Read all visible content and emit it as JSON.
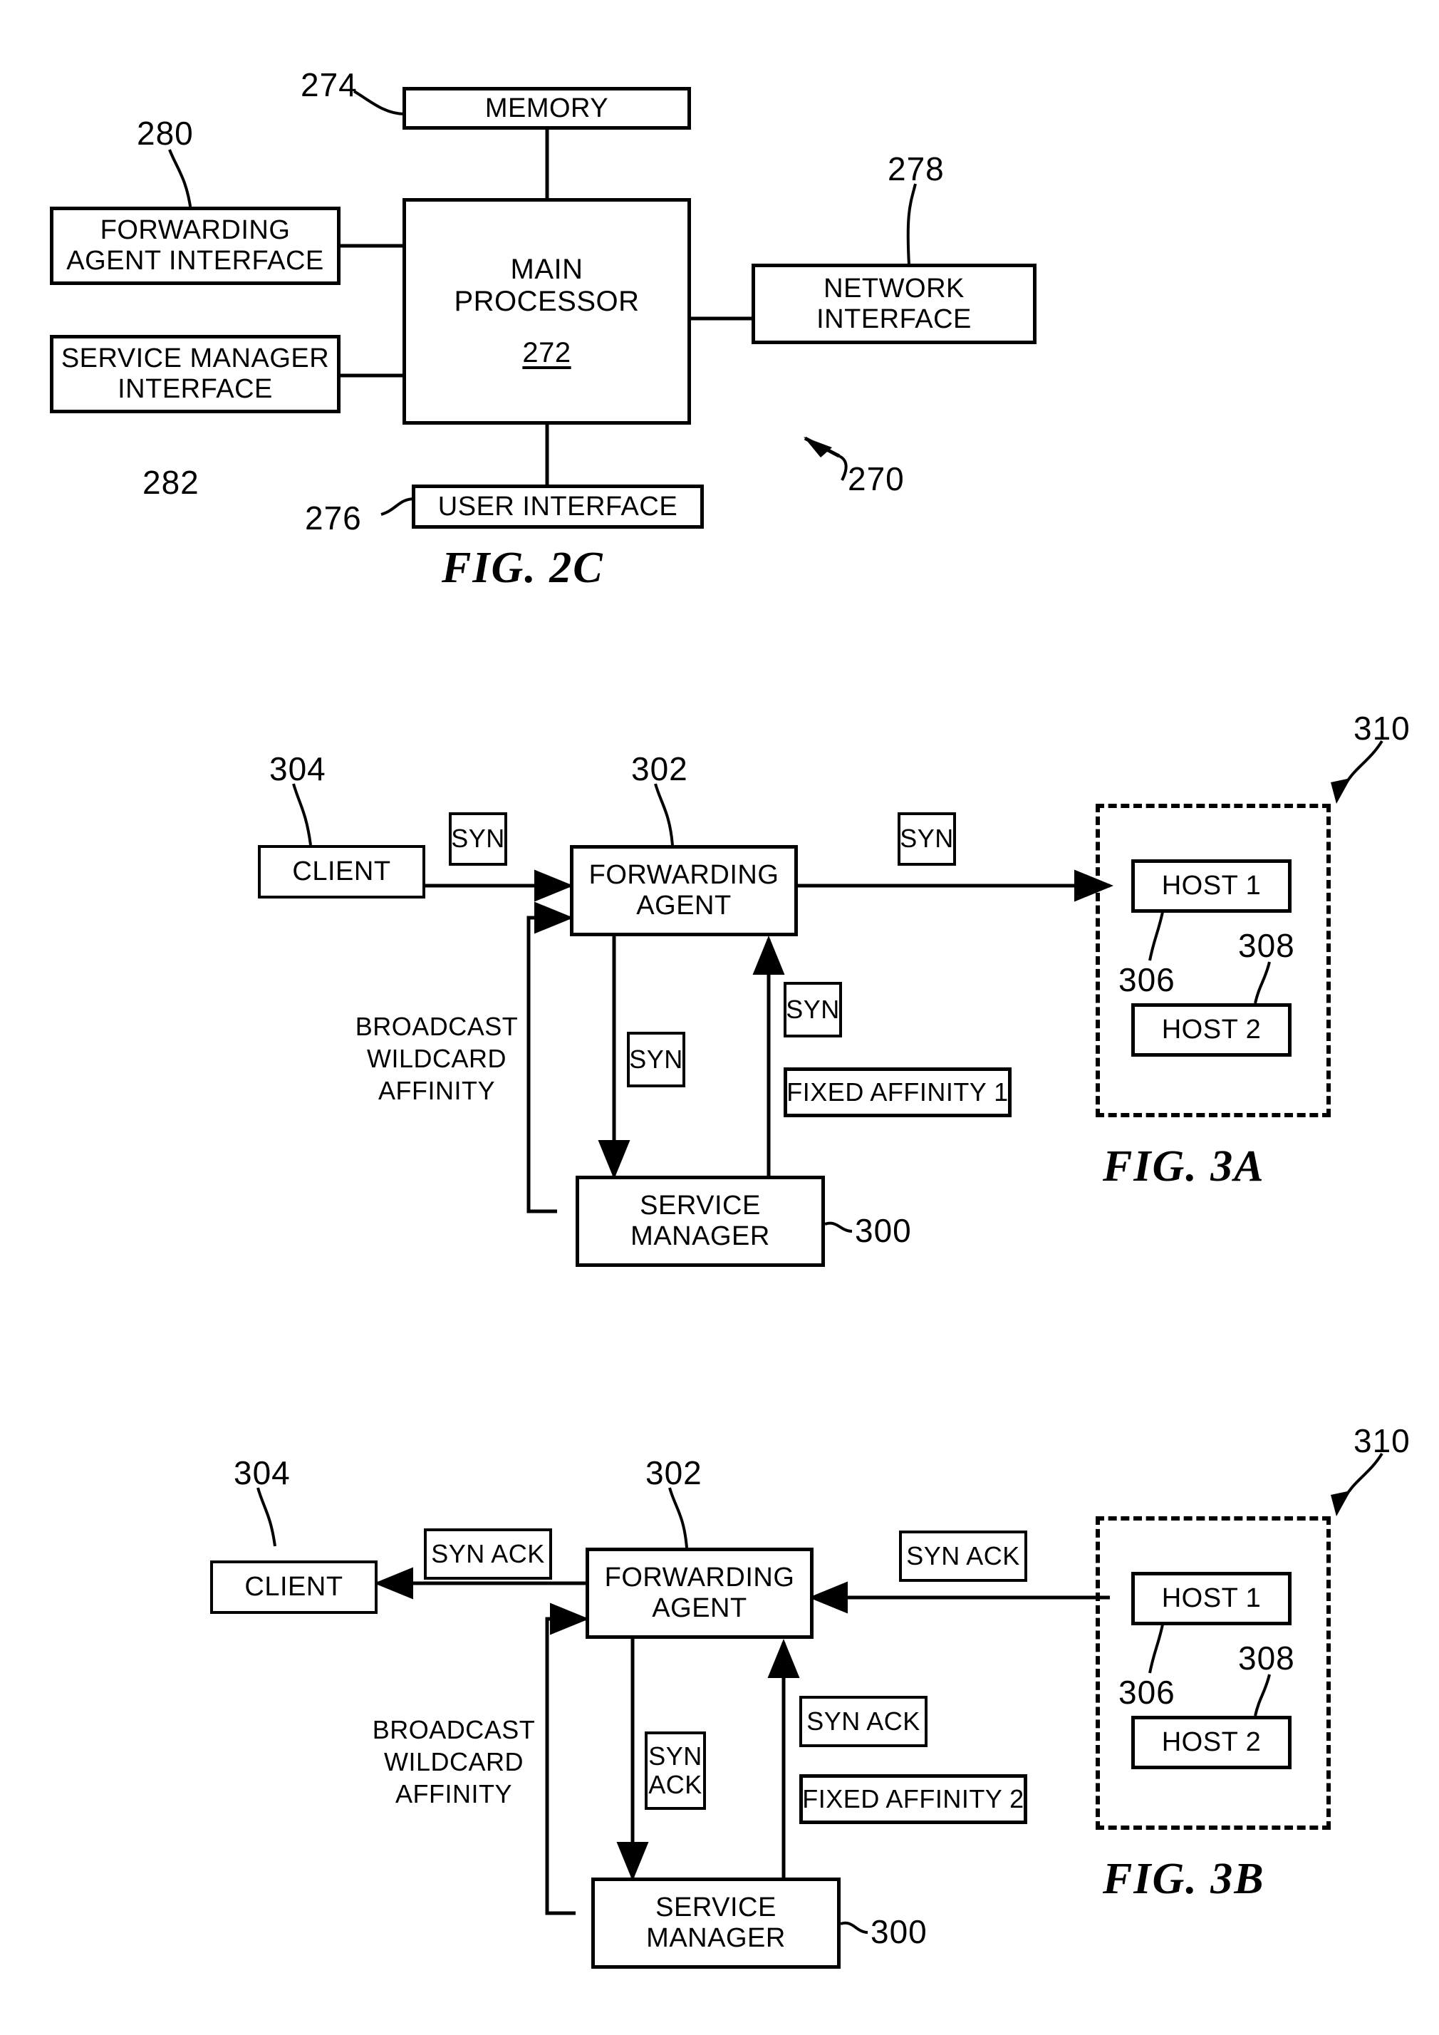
{
  "document": {
    "type": "patent-drawing-sheet",
    "figures": [
      "FIG. 2C",
      "FIG. 3A",
      "FIG. 3B"
    ]
  },
  "fig2c": {
    "caption": "FIG. 2C",
    "boxes": {
      "memory": "MEMORY",
      "forwarding_agent_interface_line1": "FORWARDING",
      "forwarding_agent_interface_line2": "AGENT INTERFACE",
      "service_manager_interface_line1": "SERVICE MANAGER",
      "service_manager_interface_line2": "INTERFACE",
      "main_processor_line1": "MAIN",
      "main_processor_line2": "PROCESSOR",
      "main_processor_ref": "272",
      "network_interface_line1": "NETWORK",
      "network_interface_line2": "INTERFACE",
      "user_interface": "USER INTERFACE"
    },
    "refs": {
      "memory": "274",
      "forwarding_agent_interface": "280",
      "service_manager_interface": "282",
      "network_interface": "278",
      "user_interface": "276",
      "system": "270"
    }
  },
  "fig3a": {
    "caption": "FIG. 3A",
    "boxes": {
      "client": "CLIENT",
      "forwarding_agent_line1": "FORWARDING",
      "forwarding_agent_line2": "AGENT",
      "service_manager_line1": "SERVICE",
      "service_manager_line2": "MANAGER",
      "host1": "HOST 1",
      "host2": "HOST 2",
      "fixed_affinity": "FIXED AFFINITY 1",
      "packet_client_to_agent": "SYN",
      "packet_agent_to_host": "SYN",
      "packet_agent_to_manager": "SYN",
      "packet_manager_to_agent": "SYN"
    },
    "labels": {
      "broadcast_wildcard_affinity_line1": "BROADCAST",
      "broadcast_wildcard_affinity_line2": "WILDCARD",
      "broadcast_wildcard_affinity_line3": "AFFINITY"
    },
    "refs": {
      "service_manager": "300",
      "forwarding_agent": "302",
      "client": "304",
      "host1": "306",
      "host2": "308",
      "host_cluster": "310"
    }
  },
  "fig3b": {
    "caption": "FIG. 3B",
    "boxes": {
      "client": "CLIENT",
      "forwarding_agent_line1": "FORWARDING",
      "forwarding_agent_line2": "AGENT",
      "service_manager_line1": "SERVICE",
      "service_manager_line2": "MANAGER",
      "host1": "HOST 1",
      "host2": "HOST 2",
      "fixed_affinity": "FIXED AFFINITY 2",
      "packet_agent_to_client": "SYN ACK",
      "packet_host_to_agent": "SYN ACK",
      "packet_agent_to_manager_line1": "SYN",
      "packet_agent_to_manager_line2": "ACK",
      "packet_manager_to_agent": "SYN ACK"
    },
    "labels": {
      "broadcast_wildcard_affinity_line1": "BROADCAST",
      "broadcast_wildcard_affinity_line2": "WILDCARD",
      "broadcast_wildcard_affinity_line3": "AFFINITY"
    },
    "refs": {
      "service_manager": "300",
      "forwarding_agent": "302",
      "client": "304",
      "host1": "306",
      "host2": "308",
      "host_cluster": "310"
    }
  }
}
